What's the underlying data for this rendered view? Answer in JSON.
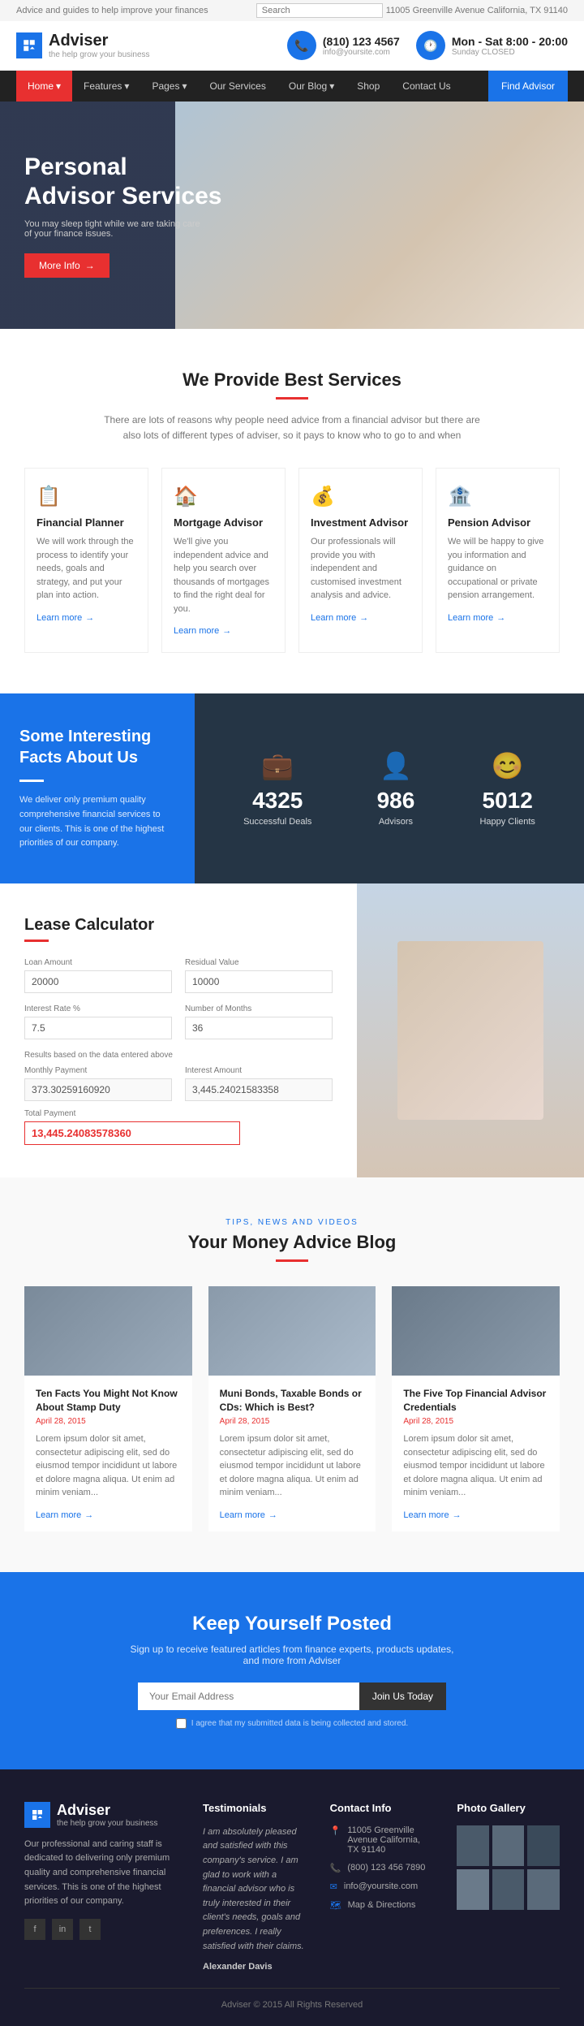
{
  "topbar": {
    "tagline": "Advice and guides to help improve your finances",
    "search_placeholder": "Search",
    "address": "11005 Greenville Avenue California, TX 91140"
  },
  "header": {
    "logo_text": "Adviser",
    "logo_sub": "the help grow your business",
    "phone": "(810) 123 4567",
    "phone_sub": "info@yoursite.com",
    "hours": "Mon - Sat 8:00 - 20:00",
    "hours_sub": "Sunday CLOSED"
  },
  "nav": {
    "items": [
      {
        "label": "Home",
        "active": true
      },
      {
        "label": "Features"
      },
      {
        "label": "Pages"
      },
      {
        "label": "Our Services"
      },
      {
        "label": "Our Blog"
      },
      {
        "label": "Shop"
      },
      {
        "label": "Contact Us"
      }
    ],
    "find_label": "Find Advisor"
  },
  "hero": {
    "title": "Personal\nAdvisor Services",
    "subtitle": "You may sleep tight while we are taking care of your finance issues.",
    "cta_label": "More Info"
  },
  "services": {
    "section_title": "We Provide Best Services",
    "section_desc": "There are lots of reasons why people need advice from a financial advisor but there are also lots of different types of adviser, so it pays to know who to go to and when",
    "items": [
      {
        "icon": "📋",
        "title": "Financial Planner",
        "desc": "We will work through the process to identify your needs, goals and strategy, and put your plan into action.",
        "link": "Learn more"
      },
      {
        "icon": "🏠",
        "title": "Mortgage Advisor",
        "desc": "We'll give you independent advice and help you search over thousands of mortgages to find the right deal for you.",
        "link": "Learn more"
      },
      {
        "icon": "💰",
        "title": "Investment Advisor",
        "desc": "Our professionals will provide you with independent and customised investment analysis and advice.",
        "link": "Learn more"
      },
      {
        "icon": "🏦",
        "title": "Pension Advisor",
        "desc": "We will be happy to give you information and guidance on occupational or private pension arrangement.",
        "link": "Learn more"
      }
    ]
  },
  "facts": {
    "title": "Some Interesting Facts About Us",
    "desc": "We deliver only premium quality comprehensive financial services to our clients. This is one of the highest priorities of our company.",
    "stats": [
      {
        "icon": "💼",
        "number": "4325",
        "label": "Successful Deals"
      },
      {
        "icon": "👤",
        "number": "986",
        "label": "Advisors"
      },
      {
        "icon": "😊",
        "number": "5012",
        "label": "Happy Clients"
      }
    ]
  },
  "calculator": {
    "title": "Lease Calculator",
    "fields": {
      "loan_amount_label": "Loan Amount",
      "loan_amount_value": "20000",
      "residual_value_label": "Residual Value",
      "residual_value_value": "10000",
      "interest_rate_label": "Interest Rate %",
      "interest_rate_value": "7.5",
      "months_label": "Number of Months",
      "months_value": "36"
    },
    "results_label": "Results based on the data entered above",
    "monthly_payment_label": "Monthly Payment",
    "monthly_payment_value": "373.30259160920",
    "interest_amount_label": "Interest Amount",
    "interest_amount_value": "3,445.24021583358",
    "total_payment_label": "Total Payment",
    "total_payment_value": "13,445.24083578360"
  },
  "blog": {
    "section_label": "TIPS, NEWS AND VIDEOS",
    "section_title": "Your Money Advice Blog",
    "posts": [
      {
        "title": "Ten Facts You Might Not Know About Stamp Duty",
        "date": "April 28, 2015",
        "excerpt": "Lorem ipsum dolor sit amet, consectetur adipiscing elit, sed do eiusmod tempor incididunt ut labore et dolore magna aliqua. Ut enim ad minim veniam...",
        "link": "Learn more",
        "bg": "#7a8a9a"
      },
      {
        "title": "Muni Bonds, Taxable Bonds or CDs: Which is Best?",
        "date": "April 28, 2015",
        "excerpt": "Lorem ipsum dolor sit amet, consectetur adipiscing elit, sed do eiusmod tempor incididunt ut labore et dolore magna aliqua. Ut enim ad minim veniam...",
        "link": "Learn more",
        "bg": "#8a9aaa"
      },
      {
        "title": "The Five Top Financial Advisor Credentials",
        "date": "April 28, 2015",
        "excerpt": "Lorem ipsum dolor sit amet, consectetur adipiscing elit, sed do eiusmod tempor incididunt ut labore et dolore magna aliqua. Ut enim ad minim veniam...",
        "link": "Learn more",
        "bg": "#6a7a8a"
      }
    ]
  },
  "newsletter": {
    "title": "Keep Yourself Posted",
    "desc": "Sign up to receive featured articles from finance experts, products updates, and more from Adviser",
    "placeholder": "Your Email Address",
    "cta_label": "Join Us Today",
    "agree_text": "I agree that my submitted data is being collected and stored."
  },
  "footer": {
    "logo_text": "Adviser",
    "logo_sub": "the help grow your business",
    "desc": "Our professional and caring staff is dedicated to delivering only premium quality and comprehensive financial services. This is one of the highest priorities of our company.",
    "social": [
      "f",
      "in",
      "t"
    ],
    "testimonials_heading": "Testimonials",
    "testimonial_text": "I am absolutely pleased and satisfied with this company's service. I am glad to work with a financial advisor who is truly interested in their client's needs, goals and preferences. I really satisfied with their claims.",
    "testimonial_author": "Alexander Davis",
    "contact_heading": "Contact Info",
    "contact_items": [
      {
        "icon": "📍",
        "text": "11005 Greenville Avenue California, TX 91140"
      },
      {
        "icon": "📞",
        "text": "(800) 123 456 7890"
      },
      {
        "icon": "✉",
        "text": "info@yoursite.com"
      },
      {
        "icon": "🗺",
        "text": "Map & Directions"
      }
    ],
    "gallery_heading": "Photo Gallery",
    "copyright": "Adviser © 2015 All Rights Reserved"
  }
}
